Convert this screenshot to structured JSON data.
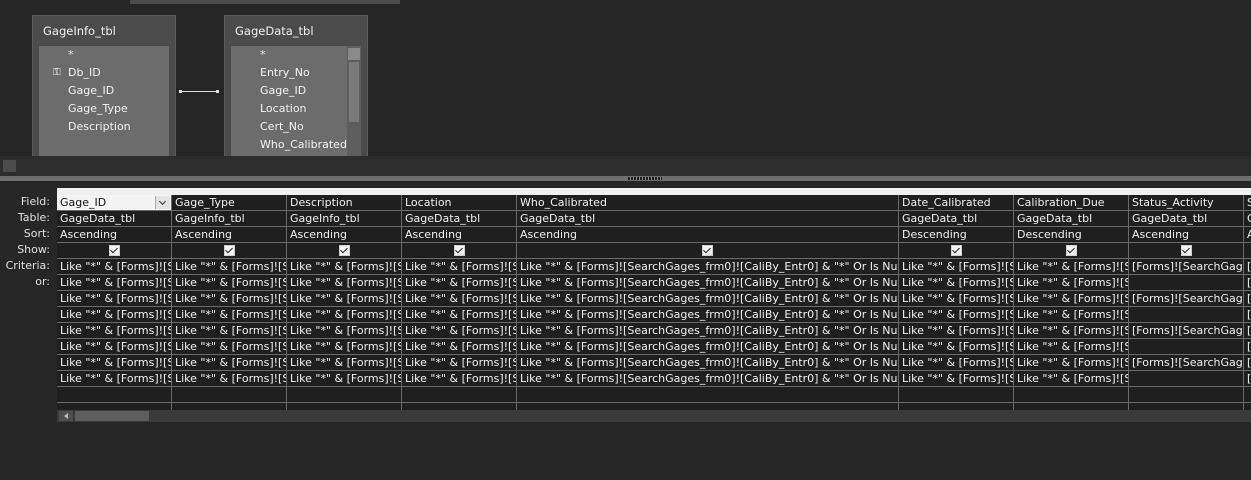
{
  "tables": [
    {
      "title": "GageInfo_tbl",
      "fields": [
        "*",
        "Db_ID",
        "Gage_ID",
        "Gage_Type",
        "Description"
      ],
      "key_icon": "key-icon"
    },
    {
      "title": "GageData_tbl",
      "fields": [
        "*",
        "Entry_No",
        "Gage_ID",
        "Location",
        "Cert_No",
        "Who_Calibrated"
      ]
    }
  ],
  "row_labels": [
    "Field:",
    "Table:",
    "Sort:",
    "Show:",
    "Criteria:",
    "or:"
  ],
  "columns": [
    {
      "field": "Gage_ID",
      "table": "GageData_tbl",
      "sort": "Ascending",
      "show": true,
      "criteria": [
        "Like \"*\" & [Forms]![S",
        "Like \"*\" & [Forms]![S",
        "Like \"*\" & [Forms]![S",
        "Like \"*\" & [Forms]![S",
        "Like \"*\" & [Forms]![S",
        "Like \"*\" & [Forms]![S",
        "Like \"*\" & [Forms]![S",
        "Like \"*\" & [Forms]![S"
      ]
    },
    {
      "field": "Gage_Type",
      "table": "GageInfo_tbl",
      "sort": "Ascending",
      "show": true,
      "criteria": [
        "Like \"*\" & [Forms]![S",
        "Like \"*\" & [Forms]![S",
        "Like \"*\" & [Forms]![S",
        "Like \"*\" & [Forms]![S",
        "Like \"*\" & [Forms]![S",
        "Like \"*\" & [Forms]![S",
        "Like \"*\" & [Forms]![S",
        "Like \"*\" & [Forms]![S"
      ]
    },
    {
      "field": "Description",
      "table": "GageInfo_tbl",
      "sort": "Ascending",
      "show": true,
      "criteria": [
        "Like \"*\" & [Forms]![S",
        "Like \"*\" & [Forms]![S",
        "Like \"*\" & [Forms]![S",
        "Like \"*\" & [Forms]![S",
        "Like \"*\" & [Forms]![S",
        "Like \"*\" & [Forms]![S",
        "Like \"*\" & [Forms]![S",
        "Like \"*\" & [Forms]![S"
      ]
    },
    {
      "field": "Location",
      "table": "GageData_tbl",
      "sort": "Ascending",
      "show": true,
      "criteria": [
        "Like \"*\" & [Forms]![S",
        "Like \"*\" & [Forms]![S",
        "Like \"*\" & [Forms]![S",
        "Like \"*\" & [Forms]![S",
        "Like \"*\" & [Forms]![S",
        "Like \"*\" & [Forms]![S",
        "Like \"*\" & [Forms]![S",
        "Like \"*\" & [Forms]![S"
      ]
    },
    {
      "field": "Who_Calibrated",
      "table": "GageData_tbl",
      "sort": "Ascending",
      "show": true,
      "criteria": [
        "Like \"*\" & [Forms]![SearchGages_frm0]![CaliBy_Entr0] & \"*\" Or Is Null",
        "Like \"*\" & [Forms]![SearchGages_frm0]![CaliBy_Entr0] & \"*\" Or Is Null",
        "Like \"*\" & [Forms]![SearchGages_frm0]![CaliBy_Entr0] & \"*\" Or Is Null",
        "Like \"*\" & [Forms]![SearchGages_frm0]![CaliBy_Entr0] & \"*\" Or Is Null",
        "Like \"*\" & [Forms]![SearchGages_frm0]![CaliBy_Entr0] & \"*\" Or Is Null",
        "Like \"*\" & [Forms]![SearchGages_frm0]![CaliBy_Entr0] & \"*\" Or Is Null",
        "Like \"*\" & [Forms]![SearchGages_frm0]![CaliBy_Entr0] & \"*\" Or Is Null",
        "Like \"*\" & [Forms]![SearchGages_frm0]![CaliBy_Entr0] & \"*\" Or Is Null"
      ]
    },
    {
      "field": "Date_Calibrated",
      "table": "GageData_tbl",
      "sort": "Descending",
      "show": true,
      "criteria": [
        "Like \"*\" & [Forms]![S",
        "Like \"*\" & [Forms]![S",
        "Like \"*\" & [Forms]![S",
        "Like \"*\" & [Forms]![S",
        "Like \"*\" & [Forms]![S",
        "Like \"*\" & [Forms]![S",
        "Like \"*\" & [Forms]![S",
        "Like \"*\" & [Forms]![S"
      ]
    },
    {
      "field": "Calibration_Due",
      "table": "GageData_tbl",
      "sort": "Descending",
      "show": true,
      "criteria": [
        "Like \"*\" & [Forms]![S",
        "Like \"*\" & [Forms]![S",
        "Like \"*\" & [Forms]![S",
        "Like \"*\" & [Forms]![S",
        "Like \"*\" & [Forms]![S",
        "Like \"*\" & [Forms]![S",
        "Like \"*\" & [Forms]![S",
        "Like \"*\" & [Forms]![S"
      ]
    },
    {
      "field": "Status_Activity",
      "table": "GageData_tbl",
      "sort": "Ascending",
      "show": true,
      "criteria": [
        "[Forms]![SearchGage",
        "",
        "[Forms]![SearchGage",
        "",
        "[Forms]![SearchGage",
        "",
        "[Forms]![SearchGage",
        ""
      ]
    },
    {
      "field": "S",
      "table": "G",
      "sort": "A",
      "show": false,
      "criteria": [
        "[",
        "[",
        "[",
        "[",
        "[",
        "[",
        "[",
        "["
      ]
    }
  ]
}
